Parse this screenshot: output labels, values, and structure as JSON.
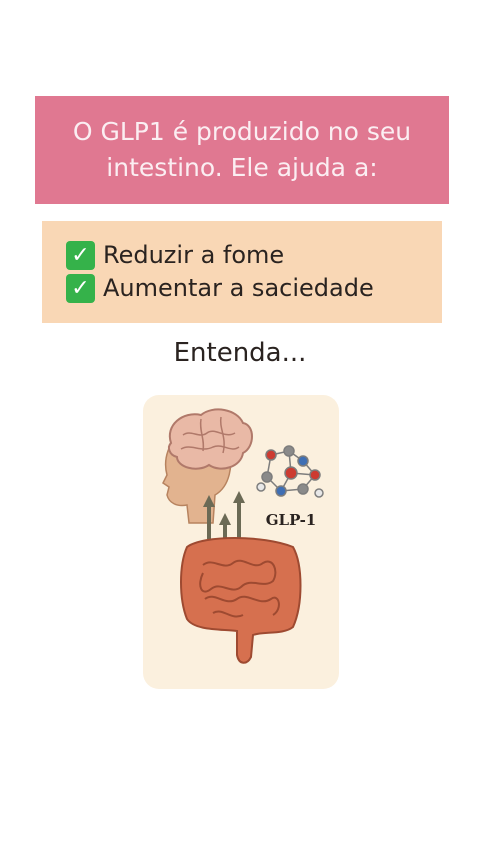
{
  "intro": {
    "line1": "O GLP1 é produzido no seu",
    "line2": "intestino. Ele ajuda a:"
  },
  "benefits": [
    {
      "icon": "check-mark-icon",
      "label": "Reduzir a fome"
    },
    {
      "icon": "check-mark-icon",
      "label": "Aumentar a saciedade"
    }
  ],
  "heading": "Entenda...",
  "illustration": {
    "molecule_label": "GLP-1"
  },
  "colors": {
    "pink_banner": "#e07891",
    "peach_banner": "#f9d7b5",
    "check_green": "#35b24a",
    "illustration_bg": "#fbf0de"
  }
}
